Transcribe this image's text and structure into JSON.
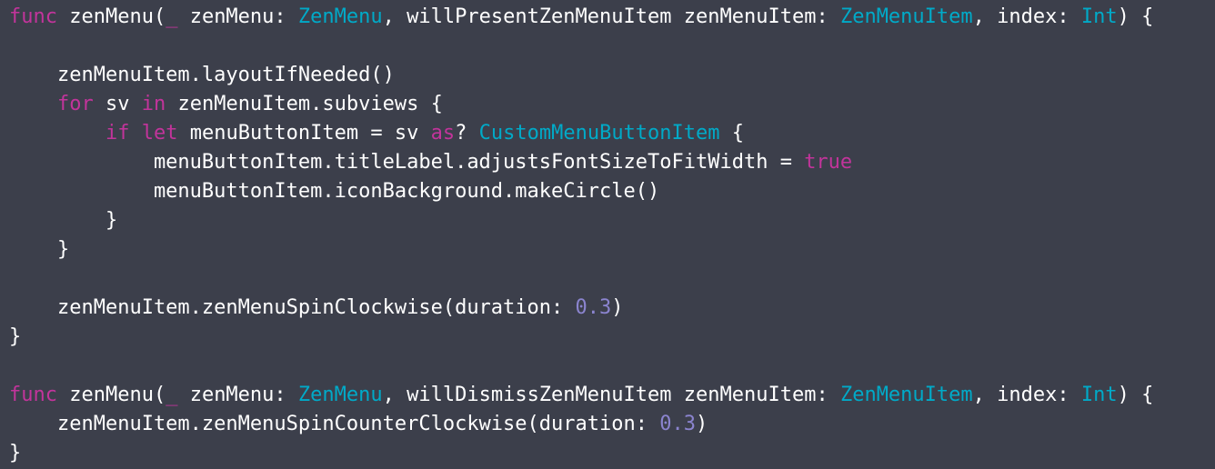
{
  "colors": {
    "background": "#3c3f4b",
    "plain": "#ffffff",
    "keyword": "#c2349b",
    "type": "#00aac8",
    "number": "#8b84cf"
  },
  "lines": [
    [
      {
        "t": "func",
        "k": "keyword"
      },
      {
        "t": " zenMenu(",
        "k": "plain"
      },
      {
        "t": "_",
        "k": "keyword"
      },
      {
        "t": " zenMenu: ",
        "k": "plain"
      },
      {
        "t": "ZenMenu",
        "k": "type"
      },
      {
        "t": ", willPresentZenMenuItem zenMenuItem: ",
        "k": "plain"
      },
      {
        "t": "ZenMenuItem",
        "k": "type"
      },
      {
        "t": ", index: ",
        "k": "plain"
      },
      {
        "t": "Int",
        "k": "type"
      },
      {
        "t": ") {",
        "k": "plain"
      }
    ],
    [],
    [
      {
        "t": "    zenMenuItem.layoutIfNeeded()",
        "k": "plain"
      }
    ],
    [
      {
        "t": "    ",
        "k": "plain"
      },
      {
        "t": "for",
        "k": "keyword"
      },
      {
        "t": " sv ",
        "k": "plain"
      },
      {
        "t": "in",
        "k": "keyword"
      },
      {
        "t": " zenMenuItem.subviews {",
        "k": "plain"
      }
    ],
    [
      {
        "t": "        ",
        "k": "plain"
      },
      {
        "t": "if",
        "k": "keyword"
      },
      {
        "t": " ",
        "k": "plain"
      },
      {
        "t": "let",
        "k": "keyword"
      },
      {
        "t": " menuButtonItem = sv ",
        "k": "plain"
      },
      {
        "t": "as",
        "k": "keyword"
      },
      {
        "t": "? ",
        "k": "plain"
      },
      {
        "t": "CustomMenuButtonItem",
        "k": "type"
      },
      {
        "t": " {",
        "k": "plain"
      }
    ],
    [
      {
        "t": "            menuButtonItem.titleLabel.adjustsFontSizeToFitWidth = ",
        "k": "plain"
      },
      {
        "t": "true",
        "k": "keyword"
      }
    ],
    [
      {
        "t": "            menuButtonItem.iconBackground.makeCircle()",
        "k": "plain"
      }
    ],
    [
      {
        "t": "        }",
        "k": "plain"
      }
    ],
    [
      {
        "t": "    }",
        "k": "plain"
      }
    ],
    [],
    [
      {
        "t": "    zenMenuItem.zenMenuSpinClockwise(duration: ",
        "k": "plain"
      },
      {
        "t": "0.3",
        "k": "number"
      },
      {
        "t": ")",
        "k": "plain"
      }
    ],
    [
      {
        "t": "}",
        "k": "plain"
      }
    ],
    [],
    [
      {
        "t": "func",
        "k": "keyword"
      },
      {
        "t": " zenMenu(",
        "k": "plain"
      },
      {
        "t": "_",
        "k": "keyword"
      },
      {
        "t": " zenMenu: ",
        "k": "plain"
      },
      {
        "t": "ZenMenu",
        "k": "type"
      },
      {
        "t": ", willDismissZenMenuItem zenMenuItem: ",
        "k": "plain"
      },
      {
        "t": "ZenMenuItem",
        "k": "type"
      },
      {
        "t": ", index: ",
        "k": "plain"
      },
      {
        "t": "Int",
        "k": "type"
      },
      {
        "t": ") {",
        "k": "plain"
      }
    ],
    [
      {
        "t": "    zenMenuItem.zenMenuSpinCounterClockwise(duration: ",
        "k": "plain"
      },
      {
        "t": "0.3",
        "k": "number"
      },
      {
        "t": ")",
        "k": "plain"
      }
    ],
    [
      {
        "t": "}",
        "k": "plain"
      }
    ]
  ]
}
